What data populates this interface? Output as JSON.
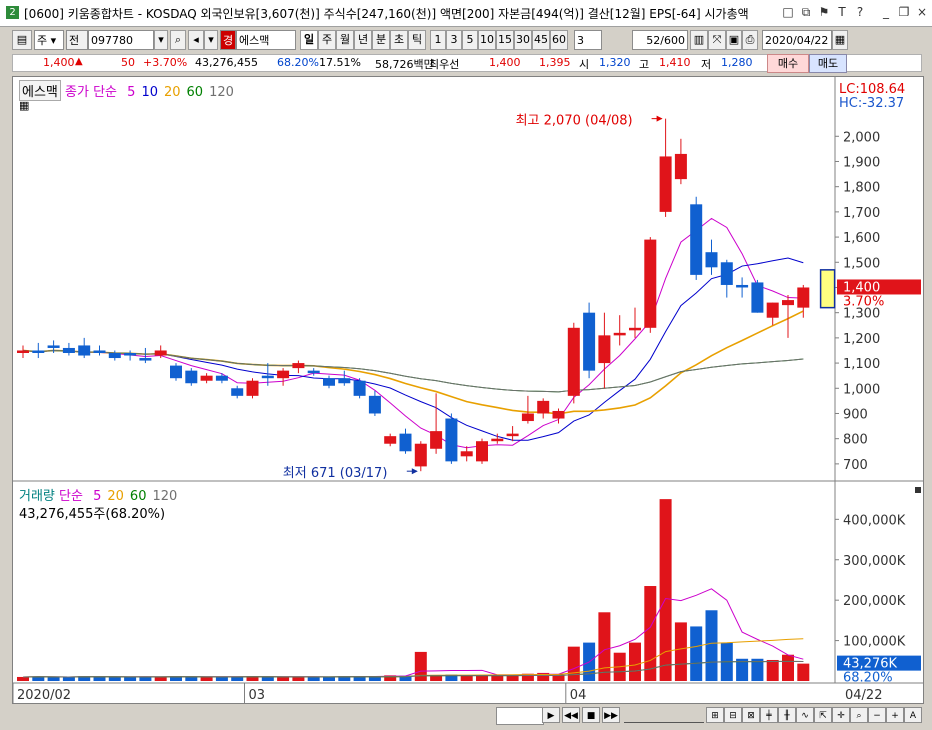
{
  "window": {
    "number": "2",
    "title": "[0600] 키움종합차트 - KOSDAQ 외국인보유[3,607(천)] 주식수[247,160(천)] 액면[200] 자본금[494(억)] 결산[12월] EPS[-64] 시가총액"
  },
  "toolbar": {
    "period_type": "주",
    "market": "전",
    "code": "097780",
    "tag": "경",
    "name": "에스맥",
    "periods": [
      "일",
      "주",
      "월",
      "년",
      "분",
      "초",
      "틱"
    ],
    "intervals": [
      "1",
      "3",
      "5",
      "10",
      "15",
      "30",
      "45",
      "60"
    ],
    "custom_interval": "3",
    "count": "52/600",
    "date": "2020/04/22"
  },
  "quote": {
    "price": "1,400",
    "change": "50",
    "change_pct": "+3.70%",
    "volume": "43,276,455",
    "volume_pct": "68.20%",
    "turnover": "17.51%",
    "amount": "58,726백만",
    "best_label": "최우선",
    "ask": "1,400",
    "bid": "1,395",
    "open_label": "시",
    "open": "1,320",
    "high_label": "고",
    "high": "1,410",
    "low_label": "저",
    "low": "1,280",
    "buy_label": "매수",
    "sell_label": "매도"
  },
  "price_panel": {
    "legend_name": "에스맥",
    "legend_ma_title": "종가 단순",
    "legend_periods": [
      "5",
      "10",
      "20",
      "60",
      "120"
    ],
    "legend_colors": [
      "#cc00cc",
      "#0000cc",
      "#e8a000",
      "#008000",
      "#707070"
    ],
    "lc": "LC:108.64",
    "hc": "HC:-32.37",
    "high_marker": "최고 2,070 (04/08)",
    "low_marker": "최저 671 (03/17)",
    "current_price": "1,400",
    "current_pct": "3.70%",
    "y_ticks": [
      "2,000",
      "1,900",
      "1,800",
      "1,700",
      "1,600",
      "1,500",
      "1,400",
      "1,300",
      "1,200",
      "1,100",
      "1,000",
      "900",
      "800",
      "700"
    ]
  },
  "volume_panel": {
    "legend_title": "거래량",
    "legend_ma_title": "단순",
    "legend_periods": [
      "5",
      "20",
      "60",
      "120"
    ],
    "legend_colors": [
      "#cc00cc",
      "#e8a000",
      "#008000",
      "#707070"
    ],
    "volume_text": "43,276,455주(68.20%)",
    "current_volume": "43,276K",
    "current_pct": "68.20%",
    "y_ticks": [
      "400,000K",
      "300,000K",
      "200,000K",
      "100,000K"
    ]
  },
  "x_axis": {
    "labels": [
      "2020/02",
      "03",
      "04"
    ],
    "right_label": "04/22"
  },
  "chart_data": {
    "type": "candlestick",
    "candles": [
      {
        "o": 1140,
        "h": 1170,
        "l": 1120,
        "c": 1150
      },
      {
        "o": 1150,
        "h": 1180,
        "l": 1120,
        "c": 1140
      },
      {
        "o": 1170,
        "h": 1190,
        "l": 1140,
        "c": 1160
      },
      {
        "o": 1160,
        "h": 1180,
        "l": 1130,
        "c": 1140
      },
      {
        "o": 1170,
        "h": 1200,
        "l": 1120,
        "c": 1130
      },
      {
        "o": 1150,
        "h": 1170,
        "l": 1130,
        "c": 1140
      },
      {
        "o": 1140,
        "h": 1150,
        "l": 1110,
        "c": 1120
      },
      {
        "o": 1140,
        "h": 1150,
        "l": 1110,
        "c": 1130
      },
      {
        "o": 1120,
        "h": 1160,
        "l": 1100,
        "c": 1110
      },
      {
        "o": 1130,
        "h": 1170,
        "l": 1120,
        "c": 1150
      },
      {
        "o": 1090,
        "h": 1100,
        "l": 1030,
        "c": 1040
      },
      {
        "o": 1070,
        "h": 1080,
        "l": 1010,
        "c": 1020
      },
      {
        "o": 1030,
        "h": 1060,
        "l": 1020,
        "c": 1050
      },
      {
        "o": 1050,
        "h": 1060,
        "l": 1020,
        "c": 1030
      },
      {
        "o": 1000,
        "h": 1010,
        "l": 960,
        "c": 970
      },
      {
        "o": 970,
        "h": 1040,
        "l": 960,
        "c": 1030
      },
      {
        "o": 1050,
        "h": 1100,
        "l": 1010,
        "c": 1040
      },
      {
        "o": 1040,
        "h": 1080,
        "l": 1010,
        "c": 1070
      },
      {
        "o": 1080,
        "h": 1110,
        "l": 1060,
        "c": 1100
      },
      {
        "o": 1070,
        "h": 1080,
        "l": 1050,
        "c": 1060
      },
      {
        "o": 1040,
        "h": 1050,
        "l": 1000,
        "c": 1010
      },
      {
        "o": 1040,
        "h": 1070,
        "l": 1010,
        "c": 1020
      },
      {
        "o": 1030,
        "h": 1040,
        "l": 960,
        "c": 970
      },
      {
        "o": 970,
        "h": 990,
        "l": 890,
        "c": 900
      },
      {
        "o": 780,
        "h": 820,
        "l": 770,
        "c": 810
      },
      {
        "o": 820,
        "h": 840,
        "l": 740,
        "c": 750
      },
      {
        "o": 690,
        "h": 790,
        "l": 671,
        "c": 780
      },
      {
        "o": 760,
        "h": 980,
        "l": 740,
        "c": 830
      },
      {
        "o": 880,
        "h": 900,
        "l": 700,
        "c": 710
      },
      {
        "o": 730,
        "h": 770,
        "l": 710,
        "c": 750
      },
      {
        "o": 710,
        "h": 800,
        "l": 700,
        "c": 790
      },
      {
        "o": 790,
        "h": 820,
        "l": 780,
        "c": 800
      },
      {
        "o": 810,
        "h": 850,
        "l": 790,
        "c": 820
      },
      {
        "o": 870,
        "h": 970,
        "l": 860,
        "c": 900
      },
      {
        "o": 900,
        "h": 960,
        "l": 880,
        "c": 950
      },
      {
        "o": 880,
        "h": 920,
        "l": 860,
        "c": 910
      },
      {
        "o": 970,
        "h": 1260,
        "l": 940,
        "c": 1240
      },
      {
        "o": 1300,
        "h": 1340,
        "l": 1040,
        "c": 1070
      },
      {
        "o": 1100,
        "h": 1300,
        "l": 1000,
        "c": 1210
      },
      {
        "o": 1210,
        "h": 1290,
        "l": 1170,
        "c": 1220
      },
      {
        "o": 1230,
        "h": 1320,
        "l": 1200,
        "c": 1240
      },
      {
        "o": 1240,
        "h": 1600,
        "l": 1220,
        "c": 1590
      },
      {
        "o": 1700,
        "h": 2070,
        "l": 1680,
        "c": 1920
      },
      {
        "o": 1830,
        "h": 1990,
        "l": 1810,
        "c": 1930
      },
      {
        "o": 1730,
        "h": 1760,
        "l": 1430,
        "c": 1450
      },
      {
        "o": 1540,
        "h": 1590,
        "l": 1450,
        "c": 1480
      },
      {
        "o": 1500,
        "h": 1510,
        "l": 1360,
        "c": 1410
      },
      {
        "o": 1410,
        "h": 1440,
        "l": 1360,
        "c": 1400
      },
      {
        "o": 1420,
        "h": 1430,
        "l": 1300,
        "c": 1300
      },
      {
        "o": 1280,
        "h": 1340,
        "l": 1250,
        "c": 1340
      },
      {
        "o": 1330,
        "h": 1370,
        "l": 1200,
        "c": 1350
      },
      {
        "o": 1320,
        "h": 1410,
        "l": 1280,
        "c": 1400
      }
    ],
    "volumes": [
      10,
      11,
      10,
      9,
      12,
      11,
      10,
      9,
      10,
      11,
      12,
      10,
      9,
      10,
      11,
      12,
      10,
      9,
      10,
      11,
      10,
      12,
      11,
      12,
      14,
      13,
      72,
      15,
      16,
      14,
      15,
      16,
      14,
      18,
      20,
      16,
      85,
      95,
      170,
      70,
      95,
      235,
      450,
      145,
      135,
      175,
      95,
      55,
      55,
      52,
      65,
      43
    ],
    "ylim_price": [
      640,
      2140
    ],
    "ylim_volume": [
      0,
      480
    ]
  }
}
